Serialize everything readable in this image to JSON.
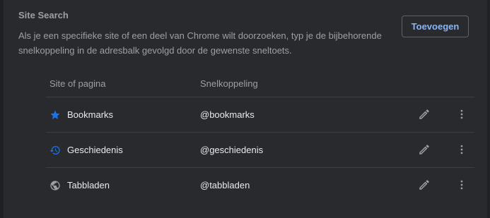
{
  "section": {
    "title": "Site Search",
    "description": "Als je een specifieke site of een deel van Chrome wilt doorzoeken, typ je de bijbehorende snelkoppeling in de adresbalk gevolgd door de gewenste sneltoets.",
    "add_button": "Toevoegen"
  },
  "table": {
    "headers": {
      "site": "Site of pagina",
      "shortcut": "Snelkoppeling"
    },
    "rows": [
      {
        "icon": "star-icon",
        "icon_color": "#1a73e8",
        "site": "Bookmarks",
        "shortcut": "@bookmarks"
      },
      {
        "icon": "history-icon",
        "icon_color": "#1a73e8",
        "site": "Geschiedenis",
        "shortcut": "@geschiedenis"
      },
      {
        "icon": "globe-icon",
        "icon_color": "#9aa0a6",
        "site": "Tabbladen",
        "shortcut": "@tabbladen"
      }
    ]
  },
  "colors": {
    "background": "#202124",
    "card": "#292a2d",
    "accent": "#8ab4f8",
    "divider": "#3c4043"
  }
}
